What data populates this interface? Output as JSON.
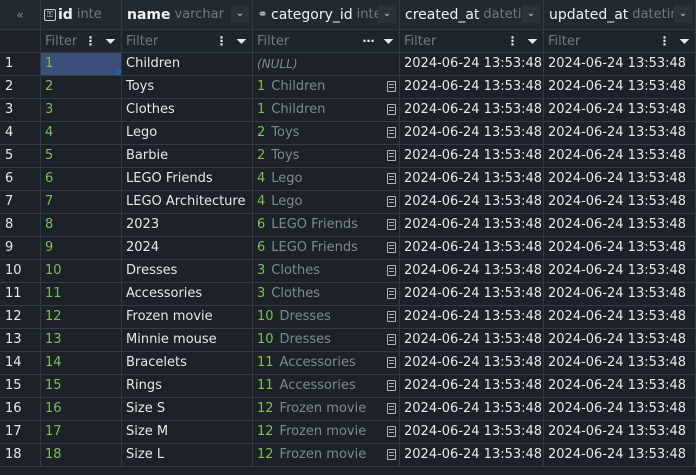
{
  "header": {
    "collapse_label": "«",
    "columns": [
      {
        "name": "id",
        "type": "inte"
      },
      {
        "name": "name",
        "type": "varchar"
      },
      {
        "name": "category_id",
        "type": "integ"
      },
      {
        "name": "created_at",
        "type": "datetim"
      },
      {
        "name": "updated_at",
        "type": "datetin"
      }
    ]
  },
  "filter": {
    "placeholders": [
      "Filter",
      "Filter",
      "Filter",
      "Filter",
      "Filter"
    ]
  },
  "null_label": "(NULL)",
  "rows": [
    {
      "num": "1",
      "id": "1",
      "name": "Children",
      "cat_id": "",
      "cat_name": "",
      "created": "2024-06-24 13:53:48",
      "updated": "2024-06-24 13:53:48"
    },
    {
      "num": "2",
      "id": "2",
      "name": "Toys",
      "cat_id": "1",
      "cat_name": "Children",
      "created": "2024-06-24 13:53:48",
      "updated": "2024-06-24 13:53:48"
    },
    {
      "num": "3",
      "id": "3",
      "name": "Clothes",
      "cat_id": "1",
      "cat_name": "Children",
      "created": "2024-06-24 13:53:48",
      "updated": "2024-06-24 13:53:48"
    },
    {
      "num": "4",
      "id": "4",
      "name": "Lego",
      "cat_id": "2",
      "cat_name": "Toys",
      "created": "2024-06-24 13:53:48",
      "updated": "2024-06-24 13:53:48"
    },
    {
      "num": "5",
      "id": "5",
      "name": "Barbie",
      "cat_id": "2",
      "cat_name": "Toys",
      "created": "2024-06-24 13:53:48",
      "updated": "2024-06-24 13:53:48"
    },
    {
      "num": "6",
      "id": "6",
      "name": "LEGO Friends",
      "cat_id": "4",
      "cat_name": "Lego",
      "created": "2024-06-24 13:53:48",
      "updated": "2024-06-24 13:53:48"
    },
    {
      "num": "7",
      "id": "7",
      "name": "LEGO Architecture",
      "cat_id": "4",
      "cat_name": "Lego",
      "created": "2024-06-24 13:53:48",
      "updated": "2024-06-24 13:53:48"
    },
    {
      "num": "8",
      "id": "8",
      "name": "2023",
      "cat_id": "6",
      "cat_name": "LEGO Friends",
      "created": "2024-06-24 13:53:48",
      "updated": "2024-06-24 13:53:48"
    },
    {
      "num": "9",
      "id": "9",
      "name": "2024",
      "cat_id": "6",
      "cat_name": "LEGO Friends",
      "created": "2024-06-24 13:53:48",
      "updated": "2024-06-24 13:53:48"
    },
    {
      "num": "10",
      "id": "10",
      "name": "Dresses",
      "cat_id": "3",
      "cat_name": "Clothes",
      "created": "2024-06-24 13:53:48",
      "updated": "2024-06-24 13:53:48"
    },
    {
      "num": "11",
      "id": "11",
      "name": "Accessories",
      "cat_id": "3",
      "cat_name": "Clothes",
      "created": "2024-06-24 13:53:48",
      "updated": "2024-06-24 13:53:48"
    },
    {
      "num": "12",
      "id": "12",
      "name": "Frozen movie",
      "cat_id": "10",
      "cat_name": "Dresses",
      "created": "2024-06-24 13:53:48",
      "updated": "2024-06-24 13:53:48"
    },
    {
      "num": "13",
      "id": "13",
      "name": "Minnie mouse",
      "cat_id": "10",
      "cat_name": "Dresses",
      "created": "2024-06-24 13:53:48",
      "updated": "2024-06-24 13:53:48"
    },
    {
      "num": "14",
      "id": "14",
      "name": "Bracelets",
      "cat_id": "11",
      "cat_name": "Accessories",
      "created": "2024-06-24 13:53:48",
      "updated": "2024-06-24 13:53:48"
    },
    {
      "num": "15",
      "id": "15",
      "name": "Rings",
      "cat_id": "11",
      "cat_name": "Accessories",
      "created": "2024-06-24 13:53:48",
      "updated": "2024-06-24 13:53:48"
    },
    {
      "num": "16",
      "id": "16",
      "name": "Size S",
      "cat_id": "12",
      "cat_name": "Frozen movie",
      "created": "2024-06-24 13:53:48",
      "updated": "2024-06-24 13:53:48"
    },
    {
      "num": "17",
      "id": "17",
      "name": "Size M",
      "cat_id": "12",
      "cat_name": "Frozen movie",
      "created": "2024-06-24 13:53:48",
      "updated": "2024-06-24 13:53:48"
    },
    {
      "num": "18",
      "id": "18",
      "name": "Size L",
      "cat_id": "12",
      "cat_name": "Frozen movie",
      "created": "2024-06-24 13:53:48",
      "updated": "2024-06-24 13:53:48"
    }
  ]
}
